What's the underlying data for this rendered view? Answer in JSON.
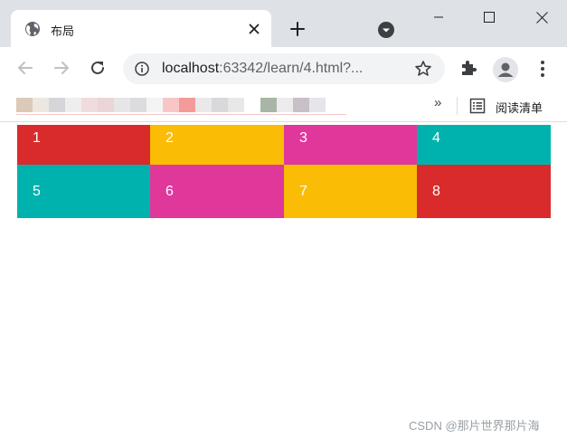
{
  "tab": {
    "title": "布局"
  },
  "toolbar": {
    "url_host": "localhost",
    "url_path": ":63342/learn/4.html?..."
  },
  "bookmarks": {
    "more_label": "»",
    "reading_list_label": "阅读清单"
  },
  "colors": {
    "red": "#d92b2b",
    "yellow": "#fbbc05",
    "pink": "#e0379b",
    "teal": "#00b2ad"
  },
  "grid": {
    "cells": [
      {
        "label": "1",
        "color": "#d92b2b"
      },
      {
        "label": "2",
        "color": "#fbbc05"
      },
      {
        "label": "3",
        "color": "#e0379b"
      },
      {
        "label": "4",
        "color": "#00b2ad"
      },
      {
        "label": "5",
        "color": "#00b2ad"
      },
      {
        "label": "6",
        "color": "#e0379b"
      },
      {
        "label": "7",
        "color": "#fbbc05"
      },
      {
        "label": "8",
        "color": "#d92b2b"
      }
    ]
  },
  "watermark": "CSDN @那片世界那片海"
}
